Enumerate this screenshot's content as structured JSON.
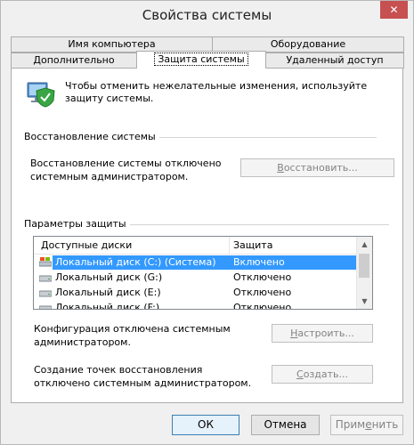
{
  "window": {
    "title": "Свойства системы",
    "close_glyph": "✕"
  },
  "tabs": {
    "row1": [
      "Имя компьютера",
      "Оборудование"
    ],
    "row2": [
      "Дополнительно",
      "Защита системы",
      "Удаленный доступ"
    ],
    "active": "Защита системы"
  },
  "intro": {
    "text": "Чтобы отменить нежелательные изменения, используйте защиту системы.",
    "icon": "system-protection-icon"
  },
  "restore": {
    "group_label": "Восстановление системы",
    "description": "Восстановление системы отключено системным администратором.",
    "button": {
      "pre": "",
      "key": "В",
      "post": "осстановить..."
    }
  },
  "protection": {
    "group_label": "Параметры защиты",
    "columns": [
      "Доступные диски",
      "Защита"
    ],
    "drives": [
      {
        "name": "Локальный диск (C:) (Система)",
        "state": "Включено",
        "icon": "system-drive-icon",
        "selected": true
      },
      {
        "name": "Локальный диск (G:)",
        "state": "Отключено",
        "icon": "drive-icon",
        "selected": false
      },
      {
        "name": "Локальный диск (E:)",
        "state": "Отключено",
        "icon": "drive-icon",
        "selected": false
      },
      {
        "name": "Локальный диск (F:)",
        "state": "Отключено",
        "icon": "drive-icon",
        "selected": false
      }
    ]
  },
  "configure": {
    "description": "Конфигурация отключена системным администратором.",
    "button": {
      "pre": "",
      "key": "Н",
      "post": "астроить..."
    }
  },
  "create": {
    "description": "Создание точек восстановления отключено системным администратором.",
    "button": {
      "pre": "",
      "key": "С",
      "post": "оздать..."
    }
  },
  "footer": {
    "ok": "ОК",
    "cancel": "Отмена",
    "apply": {
      "pre": "Прим",
      "key": "е",
      "post": "нить"
    }
  }
}
